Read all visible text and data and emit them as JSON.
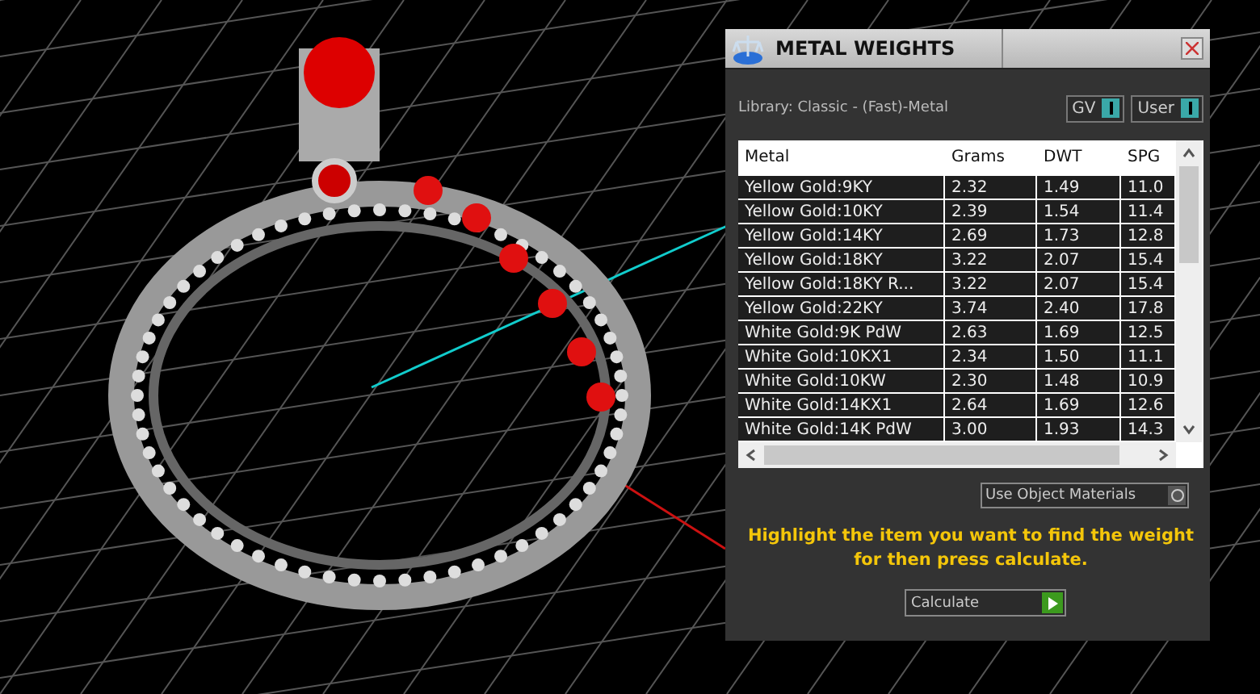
{
  "window": {
    "title": "METAL WEIGHTS"
  },
  "library": "Library: Classic - (Fast)-Metal",
  "toggles": [
    {
      "label": "GV",
      "on": true
    },
    {
      "label": "User",
      "on": true
    }
  ],
  "table": {
    "columns": [
      "Metal",
      "Grams",
      "DWT",
      "SPG"
    ],
    "rows": [
      [
        "Yellow Gold:9KY",
        "2.32",
        "1.49",
        "11.0"
      ],
      [
        "Yellow Gold:10KY",
        "2.39",
        "1.54",
        "11.4"
      ],
      [
        "Yellow Gold:14KY",
        "2.69",
        "1.73",
        "12.8"
      ],
      [
        "Yellow Gold:18KY",
        "3.22",
        "2.07",
        "15.4"
      ],
      [
        "Yellow Gold:18KY R...",
        "3.22",
        "2.07",
        "15.4"
      ],
      [
        "Yellow Gold:22KY",
        "3.74",
        "2.40",
        "17.8"
      ],
      [
        "White Gold:9K PdW",
        "2.63",
        "1.69",
        "12.5"
      ],
      [
        "White Gold:10KX1",
        "2.34",
        "1.50",
        "11.1"
      ],
      [
        "White Gold:10KW",
        "2.30",
        "1.48",
        "10.9"
      ],
      [
        "White Gold:14KX1",
        "2.64",
        "1.69",
        "12.6"
      ],
      [
        "White Gold:14K PdW",
        "3.00",
        "1.93",
        "14.3"
      ]
    ]
  },
  "use_object_materials": {
    "label": "Use Object Materials",
    "on": false
  },
  "hint": "Highlight the item you want to find the weight for then press calculate.",
  "calculate": "Calculate"
}
